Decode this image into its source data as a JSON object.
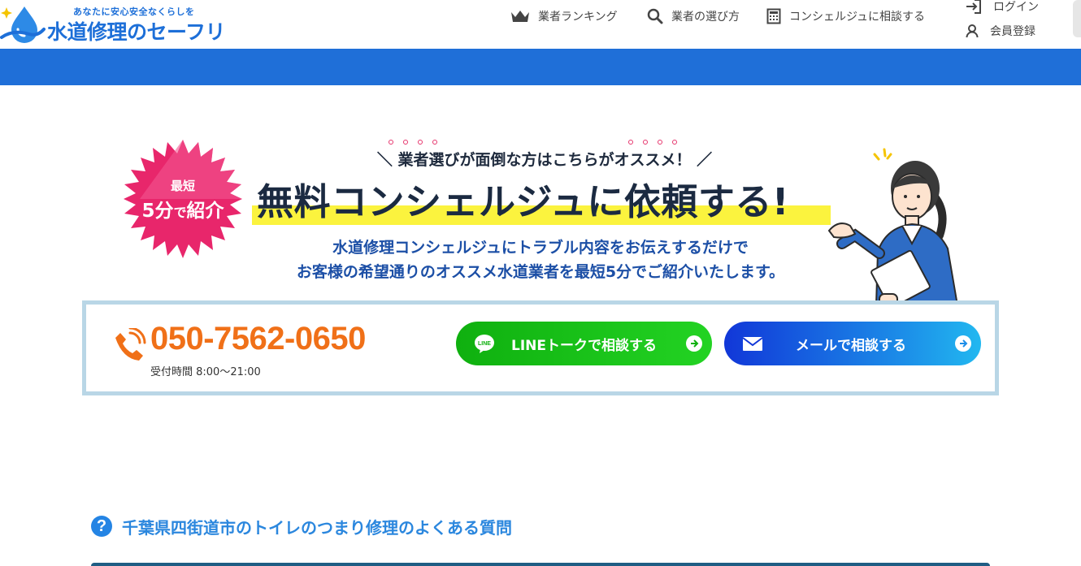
{
  "header": {
    "logo": {
      "tagline": "あなたに安心安全なくらしを",
      "name": "水道修理のセーフリー"
    },
    "nav": [
      {
        "label": "業者ランキング",
        "icon": "crown-icon"
      },
      {
        "label": "業者の選び方",
        "icon": "search-icon"
      },
      {
        "label": "コンシェルジュに相談する",
        "icon": "calculator-icon"
      }
    ],
    "account": [
      {
        "label": "ログイン",
        "icon": "login-icon"
      },
      {
        "label": "会員登録",
        "icon": "user-icon"
      }
    ]
  },
  "banner": {
    "badge_line1": "最短",
    "badge_num": "5分",
    "badge_mid": "で",
    "badge_tail": "紹介",
    "subcatch": "＼ 業者選びが面倒な方はこちらがオススメ！ ／",
    "headline": "無料コンシェルジュに依頼する!",
    "desc_line1": "水道修理コンシェルジュにトラブル内容をお伝えするだけで",
    "desc_line2": "お客様の希望通りのオススメ水道業者を最短5分でご紹介いたします。"
  },
  "contact": {
    "phone_number": "050-7562-0650",
    "phone_hours": "受付時間 8:00〜21:00",
    "line_button": "LINEトークで相談する",
    "mail_button": "メールで相談する",
    "line_icon_text": "LINE"
  },
  "faq": {
    "icon_text": "?",
    "title": "千葉県四街道市のトイレのつまり修理のよくある質問"
  },
  "colors": {
    "brand_blue": "#1f6fd8",
    "phone_orange": "#f07018",
    "line_green": "#0fb00f",
    "badge_pink": "#e8266b",
    "highlight_yellow": "#fbf33e"
  }
}
